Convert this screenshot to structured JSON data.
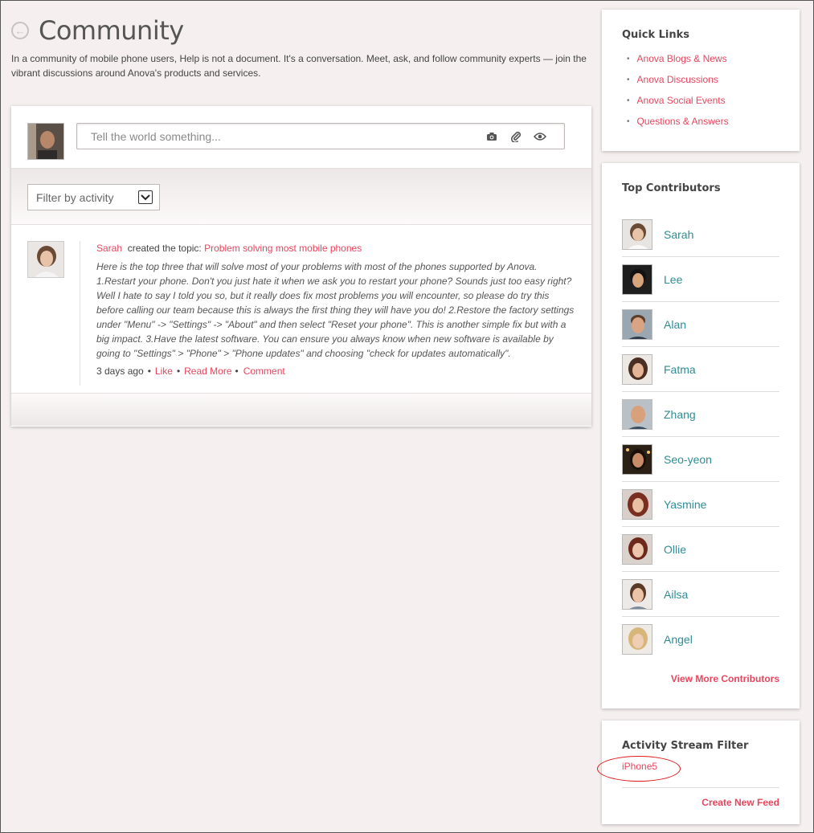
{
  "header": {
    "title": "Community",
    "description": "In a community of mobile phone users, Help is not a document. It's a conversation. Meet, ask, and follow community experts — join the vibrant discussions around Anova's products and services."
  },
  "composer": {
    "placeholder": "Tell the world something...",
    "icons": [
      "camera-icon",
      "paperclip-icon",
      "eye-icon"
    ]
  },
  "filter": {
    "selected": "Filter by activity"
  },
  "post": {
    "author": "Sarah",
    "action": "created the topic:",
    "topic": "Problem solving most mobile phones",
    "text": "Here is the top three that will solve most of your problems with most of the phones supported by Anova. 1.Restart your phone. Don't you just hate it when we ask you to restart your phone? Sounds just too easy right? Well I hate to say I told you so, but it really does fix most problems you will encounter, so please do try this before calling our team because this is always the first thing they will have you do! 2.Restore the factory settings under \"Menu\" -> \"Settings\" -> \"About\" and then select \"Reset your phone\". This is another simple fix but with a big impact. 3.Have the latest software. You can ensure you always know when new software is available by going to \"Settings\" > \"Phone\" > \"Phone updates\" and choosing \"check for updates automatically\".",
    "time": "3 days ago",
    "like": "Like",
    "read_more": "Read More",
    "comment": "Comment"
  },
  "quick_links": {
    "title": "Quick Links",
    "items": [
      "Anova Blogs & News",
      "Anova Discussions",
      "Anova Social Events",
      "Questions & Answers"
    ]
  },
  "contributors": {
    "title": "Top Contributors",
    "items": [
      "Sarah",
      "Lee",
      "Alan",
      "Fatma",
      "Zhang",
      "Seo-yeon",
      "Yasmine",
      "Ollie",
      "Ailsa",
      "Angel"
    ],
    "view_more": "View More Contributors"
  },
  "activity_filter": {
    "title": "Activity Stream Filter",
    "item": "iPhone5",
    "create": "Create New Feed"
  },
  "colors": {
    "accent": "#e8455d",
    "contributor_link": "#2f8d95",
    "background": "#f5f0ef",
    "annotation": "#e01818"
  }
}
